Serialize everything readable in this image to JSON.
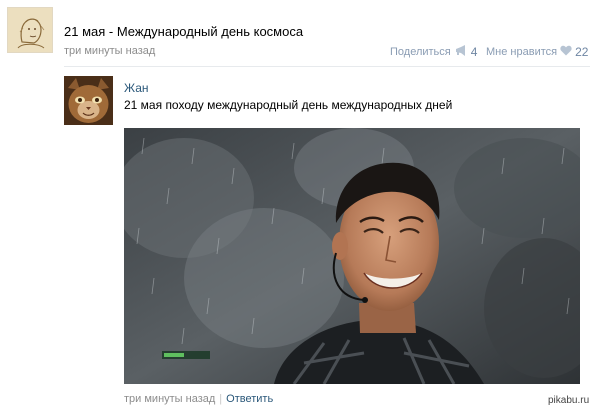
{
  "post": {
    "title": "21 мая - Международный день космоса",
    "time": "три минуты назад",
    "share_label": "Поделиться",
    "share_count": "4",
    "like_label": "Мне нравится",
    "like_count": "22"
  },
  "comment": {
    "author": "Жан",
    "text": "21 мая походу международный день международных дней",
    "time": "три минуты назад",
    "separator": "|",
    "reply_label": "Ответить"
  },
  "watermark": "pikabu.ru",
  "colors": {
    "link": "#2b587a",
    "meta": "#8c8c8c",
    "action": "#8a9cb3"
  },
  "icons": {
    "share": "megaphone-icon",
    "like": "heart-icon"
  }
}
